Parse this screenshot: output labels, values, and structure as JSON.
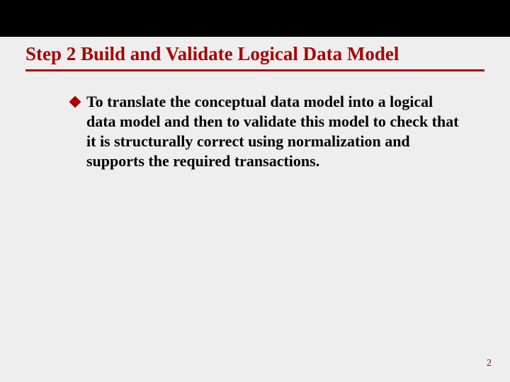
{
  "slide": {
    "title": "Step 2 Build and Validate Logical Data Model",
    "bullets": [
      {
        "text": "To translate the conceptual data model into a logical data model and then to validate this model to check that it is structurally correct using normalization and supports the required transactions."
      }
    ],
    "page_number": "2"
  }
}
